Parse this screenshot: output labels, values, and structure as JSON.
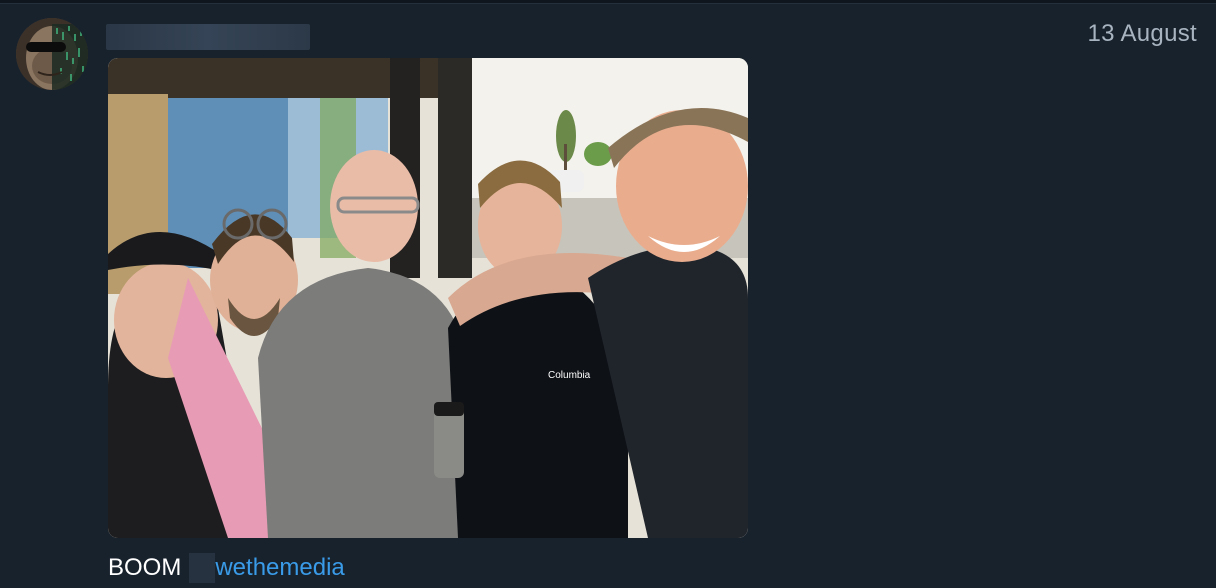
{
  "message": {
    "date": "13 August",
    "caption": {
      "text": "BOOM",
      "hashtag": "wethemedia"
    },
    "photo": {
      "description_icon": "group-selfie-photo",
      "shirt_logo": "Columbia"
    }
  },
  "colors": {
    "background": "#18222d",
    "date_text": "#a8b4c0",
    "link": "#3a9be8",
    "caption_text": "#ffffff"
  }
}
